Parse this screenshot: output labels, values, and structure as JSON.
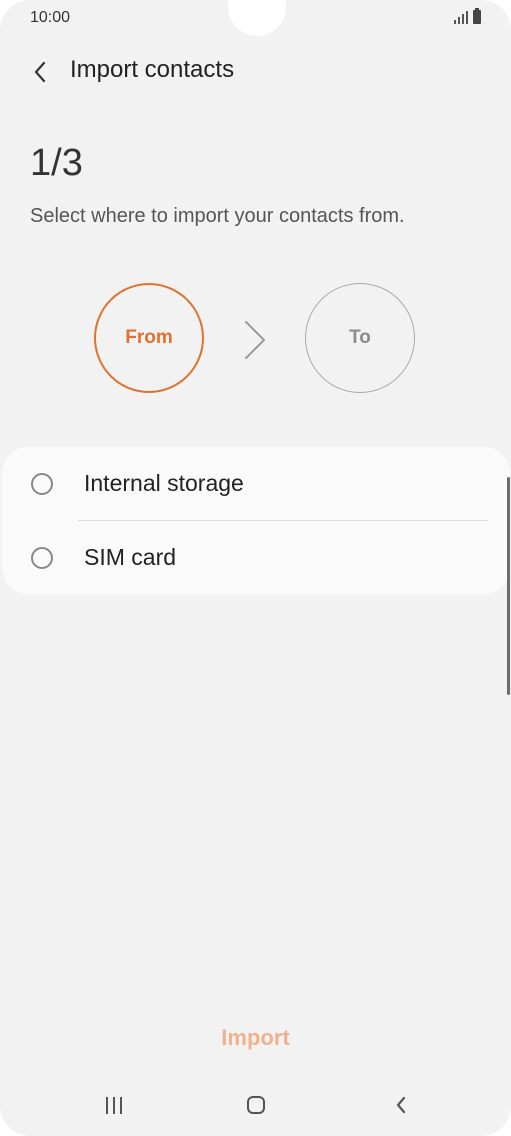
{
  "status_bar": {
    "time": "10:00",
    "icons": [
      "signal-icon",
      "battery-icon"
    ]
  },
  "header": {
    "back_icon": "chevron-left-icon",
    "title": "Import contacts"
  },
  "step": {
    "indicator": "1/3",
    "description": "Select where to import your contacts from."
  },
  "flow": {
    "from_label": "From",
    "to_label": "To",
    "arrow_icon": "chevron-right-icon",
    "active_color": "#e0722e",
    "inactive_color": "#8c8c8c"
  },
  "options": [
    {
      "label": "Internal storage",
      "selected": false
    },
    {
      "label": "SIM card",
      "selected": false
    }
  ],
  "footer": {
    "import_label": "Import",
    "import_enabled": false,
    "import_color": "#efb291"
  },
  "nav_bar": {
    "icons": [
      "recents-icon",
      "home-icon",
      "back-icon"
    ]
  }
}
